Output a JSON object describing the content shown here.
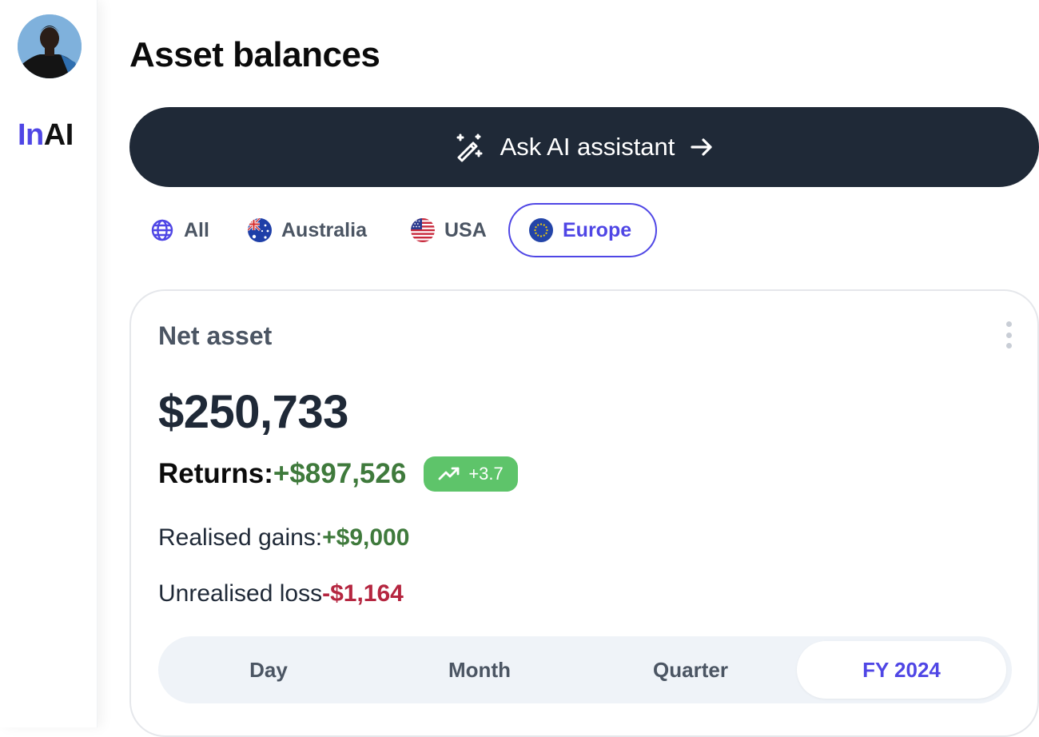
{
  "brand": {
    "logo_prefix": "In",
    "logo_suffix": "AI"
  },
  "page": {
    "title": "Asset balances"
  },
  "ai_button": {
    "label": "Ask AI assistant"
  },
  "region_tabs": [
    {
      "label": "All",
      "icon": "globe-icon"
    },
    {
      "label": "Australia",
      "icon": "australia-flag-icon"
    },
    {
      "label": "USA",
      "icon": "usa-flag-icon"
    },
    {
      "label": "Europe",
      "icon": "eu-flag-icon",
      "selected": true
    }
  ],
  "card": {
    "title": "Net asset",
    "net_value": "$250,733",
    "returns_label": "Returns:",
    "returns_value": "+$897,526",
    "returns_badge": "+3.7",
    "realised_label": "Realised gains:",
    "realised_value": "+$9,000",
    "unrealised_label": "Unrealised loss",
    "unrealised_value": "-$1,164"
  },
  "periods": [
    {
      "label": "Day"
    },
    {
      "label": "Month"
    },
    {
      "label": "Quarter"
    },
    {
      "label": "FY 2024",
      "selected": true
    }
  ],
  "colors": {
    "accent": "#4f46e5",
    "dark": "#1f2937",
    "positive": "#3f7a3c",
    "negative": "#b52640",
    "badge": "#5ec46a"
  }
}
